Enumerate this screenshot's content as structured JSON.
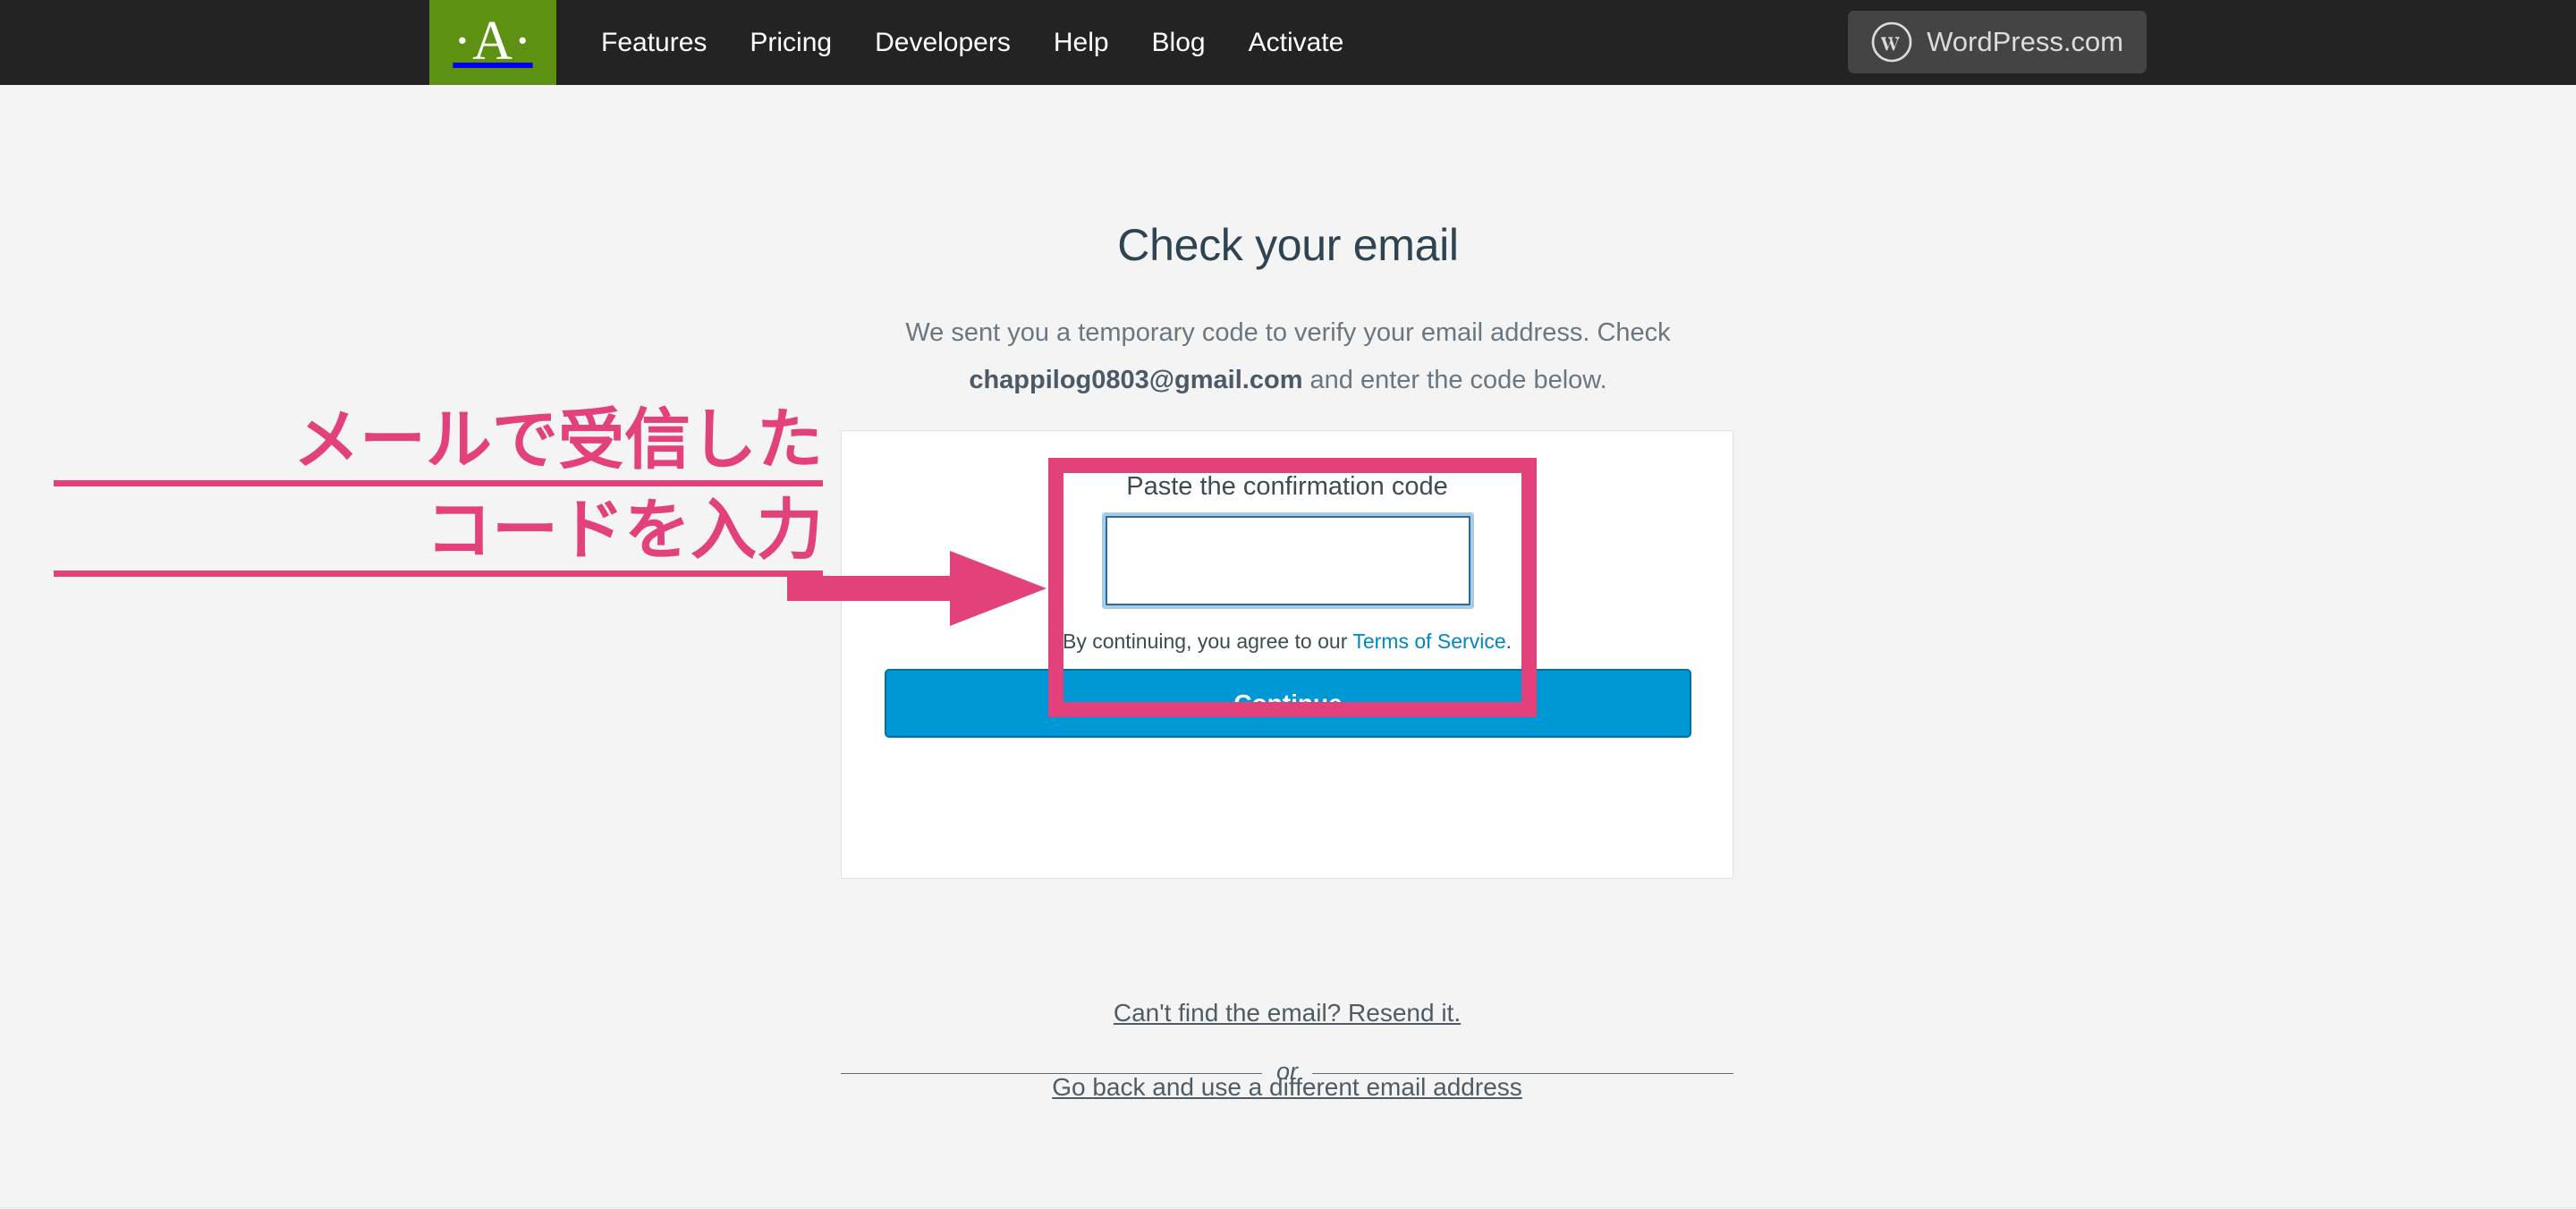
{
  "topbar": {
    "logo_mark": "·A·",
    "logo_name": "akismet-logo",
    "nav_items": [
      {
        "label": "Features",
        "name": "nav-features"
      },
      {
        "label": "Pricing",
        "name": "nav-pricing"
      },
      {
        "label": "Developers",
        "name": "nav-developers"
      },
      {
        "label": "Help",
        "name": "nav-help"
      },
      {
        "label": "Blog",
        "name": "nav-blog"
      },
      {
        "label": "Activate",
        "name": "nav-activate"
      }
    ],
    "wordpress_button_label": "WordPress.com",
    "background_color": "#232323",
    "logo_background_color": "#5d9111"
  },
  "main": {
    "title": "Check your email",
    "subtitle_prefix": "We sent you a temporary code to verify your email address. Check ",
    "subtitle_email": "chappilog0803@gmail.com",
    "subtitle_suffix": " and enter the code below."
  },
  "card": {
    "field_label": "Paste the confirmation code",
    "code_value": "",
    "code_placeholder": "",
    "tos_prefix": "By continuing, you agree to our ",
    "tos_link": "Terms of Service",
    "tos_suffix": ".",
    "continue_label": "Continue",
    "continue_color": "#0098d4",
    "link_color": "#0087be"
  },
  "footer_links": {
    "resend": "Can't find the email? Resend it.",
    "or": "or",
    "go_back": "Go back and use a different email address"
  },
  "annotations": {
    "line1": "メールで受信した",
    "line2": "コードを入力",
    "color": "#e2417c",
    "arrow_name": "annotation-arrow",
    "box_name": "annotation-highlight-box"
  }
}
